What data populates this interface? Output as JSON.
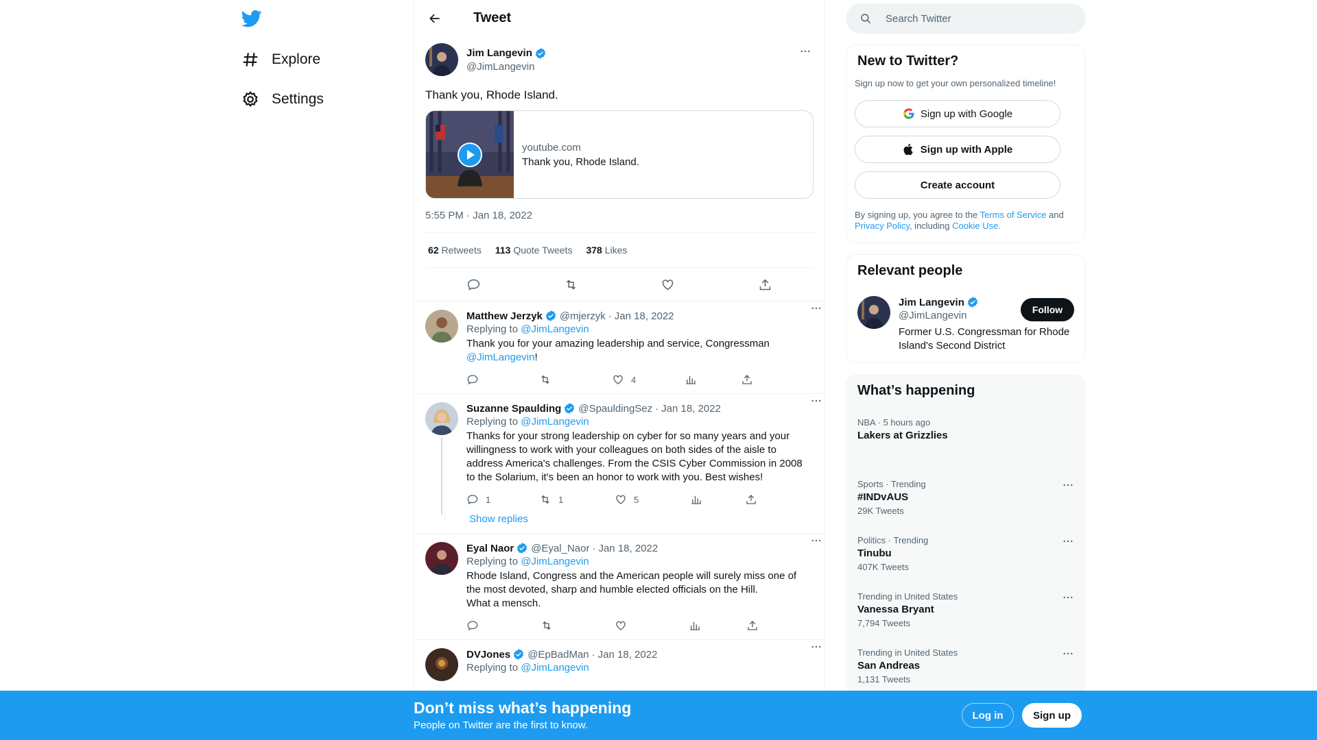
{
  "colors": {
    "accent": "#1d9bf0",
    "text": "#0f1419",
    "secondary": "#536471",
    "border": "#eff3f4"
  },
  "nav": {
    "logo": "twitter-bird-icon",
    "items": [
      {
        "label": "Explore",
        "icon": "hashtag-icon"
      },
      {
        "label": "Settings",
        "icon": "gear-icon"
      }
    ]
  },
  "header": {
    "title": "Tweet",
    "back_icon": "arrow-left-icon"
  },
  "main_tweet": {
    "name": "Jim Langevin",
    "handle": "@JimLangevin",
    "text": "Thank you, Rhode Island.",
    "card": {
      "domain": "youtube.com",
      "title": "Thank you, Rhode Island."
    },
    "timestamp": "5:55 PM · Jan 18, 2022",
    "stats": {
      "retweets": "62",
      "retweets_label": "Retweets",
      "quotes": "113",
      "quotes_label": "Quote Tweets",
      "likes": "378",
      "likes_label": "Likes"
    }
  },
  "replies": [
    {
      "name": "Matthew Jerzyk",
      "handle": "@mjerzyk",
      "date": "Jan 18, 2022",
      "replying_label": "Replying to",
      "replying_to": "@JimLangevin",
      "text": "Thank you for your amazing leadership and service, Congressman",
      "mention": "@JimLangevin",
      "text_end": "!",
      "replies": "",
      "retweets": "",
      "likes": "4"
    },
    {
      "name": "Suzanne Spaulding",
      "handle": "@SpauldingSez",
      "date": "Jan 18, 2022",
      "replying_label": "Replying to",
      "replying_to": "@JimLangevin",
      "text": "Thanks for your strong leadership on cyber for so many years and your willingness to work with your colleagues on both sides of the aisle to address America's challenges. From the CSIS Cyber Commission in 2008 to the Solarium, it's been an honor to work with you. Best wishes!",
      "replies": "1",
      "retweets": "1",
      "likes": "5",
      "show_replies": "Show replies"
    },
    {
      "name": "Eyal Naor",
      "handle": "@Eyal_Naor",
      "date": "Jan 18, 2022",
      "replying_label": "Replying to",
      "replying_to": "@JimLangevin",
      "text_line1": "Rhode Island, Congress and the American people will surely miss one of the most devoted, sharp and humble elected officials on the Hill.",
      "text_line2": "What a mensch.",
      "replies": "",
      "retweets": "",
      "likes": ""
    },
    {
      "name": "DVJones",
      "handle": "@EpBadMan",
      "date": "Jan 18, 2022",
      "replying_label": "Replying to",
      "replying_to": "@JimLangevin"
    }
  ],
  "search": {
    "placeholder": "Search Twitter"
  },
  "new_to_twitter": {
    "title": "New to Twitter?",
    "subtitle": "Sign up now to get your own personalized timeline!",
    "google": "Sign up with Google",
    "apple": "Sign up with Apple",
    "create": "Create account",
    "legal_prefix": "By signing up, you agree to the",
    "terms": "Terms of Service",
    "and": "and",
    "privacy": "Privacy Policy",
    "including": ", including",
    "cookie": "Cookie Use."
  },
  "relevant": {
    "title": "Relevant people",
    "name": "Jim Langevin",
    "handle": "@JimLangevin",
    "bio": "Former U.S. Congressman for Rhode Island's Second District",
    "follow": "Follow"
  },
  "happening": {
    "title": "What’s happening",
    "trends": [
      {
        "category": "NBA · 5 hours ago",
        "title": "Lakers at Grizzlies",
        "count": ""
      },
      {
        "category": "Sports · Trending",
        "title": "#INDvAUS",
        "count": "29K Tweets"
      },
      {
        "category": "Politics · Trending",
        "title": "Tinubu",
        "count": "407K Tweets"
      },
      {
        "category": "Trending in United States",
        "title": "Vanessa Bryant",
        "count": "7,794 Tweets"
      },
      {
        "category": "Trending in United States",
        "title": "San Andreas",
        "count": "1,131 Tweets"
      }
    ]
  },
  "banner": {
    "title": "Don’t miss what’s happening",
    "subtitle": "People on Twitter are the first to know.",
    "login": "Log in",
    "signup": "Sign up"
  }
}
